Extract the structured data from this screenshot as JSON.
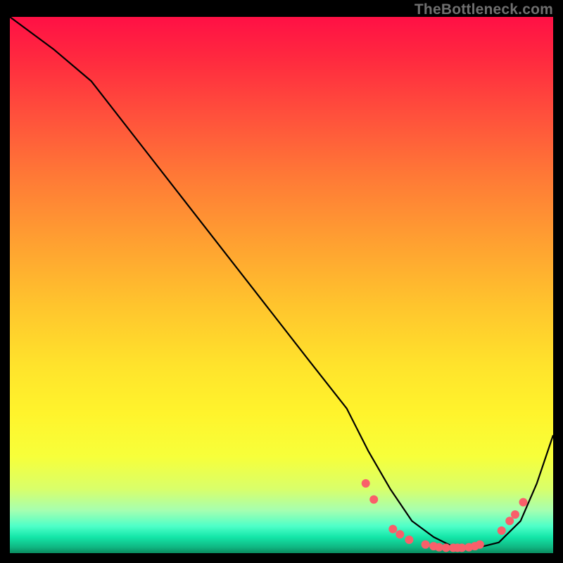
{
  "watermark": "TheBottleneck.com",
  "chart_data": {
    "type": "line",
    "title": "",
    "xlabel": "",
    "ylabel": "",
    "xlim": [
      0,
      100
    ],
    "ylim": [
      0,
      100
    ],
    "series": [
      {
        "name": "curve",
        "x": [
          0,
          8,
          15,
          25,
          35,
          45,
          55,
          62,
          66,
          70,
          74,
          78,
          82,
          86,
          90,
          94,
          97,
          100
        ],
        "y": [
          100,
          94,
          88,
          75,
          62,
          49,
          36,
          27,
          19,
          12,
          6,
          3,
          1,
          1,
          2,
          6,
          13,
          22
        ]
      }
    ],
    "markers": {
      "name": "dots",
      "color": "#f95f6a",
      "points": [
        {
          "x": 65.5,
          "y": 13.0
        },
        {
          "x": 67.0,
          "y": 10.0
        },
        {
          "x": 70.5,
          "y": 4.5
        },
        {
          "x": 71.8,
          "y": 3.5
        },
        {
          "x": 73.5,
          "y": 2.5
        },
        {
          "x": 76.5,
          "y": 1.6
        },
        {
          "x": 78.0,
          "y": 1.3
        },
        {
          "x": 79.0,
          "y": 1.1
        },
        {
          "x": 80.3,
          "y": 1.0
        },
        {
          "x": 81.6,
          "y": 1.0
        },
        {
          "x": 82.4,
          "y": 1.0
        },
        {
          "x": 83.2,
          "y": 1.0
        },
        {
          "x": 84.5,
          "y": 1.1
        },
        {
          "x": 85.6,
          "y": 1.3
        },
        {
          "x": 86.5,
          "y": 1.6
        },
        {
          "x": 90.5,
          "y": 4.2
        },
        {
          "x": 92.0,
          "y": 6.0
        },
        {
          "x": 93.0,
          "y": 7.2
        },
        {
          "x": 94.5,
          "y": 9.5
        }
      ]
    }
  }
}
